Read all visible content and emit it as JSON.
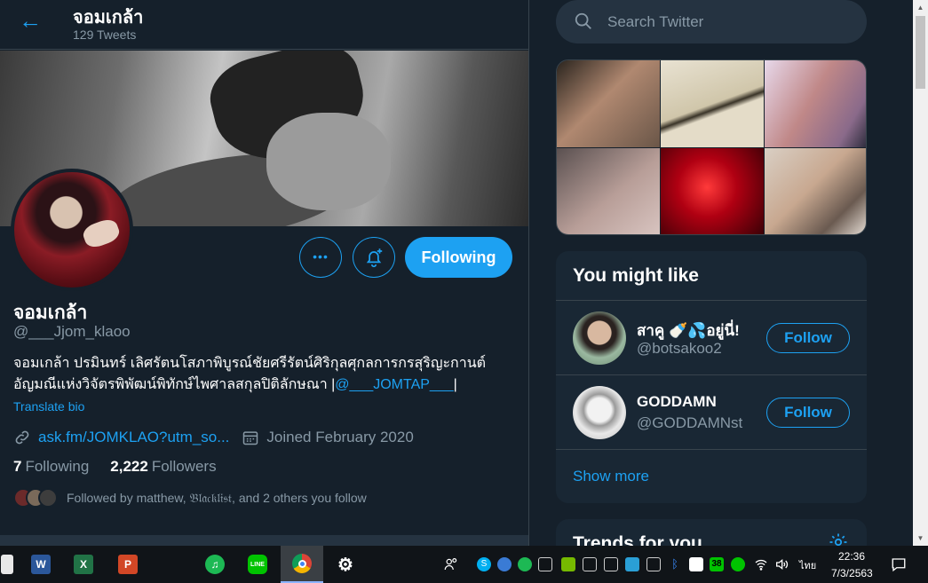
{
  "header": {
    "back_glyph": "←",
    "name": "จอมเกล้า",
    "tweet_count": "129 Tweets"
  },
  "profile": {
    "name": "จอมเกล้า",
    "handle": "@___Jjom_klaoo",
    "bio_text": "จอมเกล้า ปรมินทร์ เลิศรัตนโสภาพิบูรณ์ชัยศรีรัตน์ศิริกุลศุกลการกรสุริญะกานต์ อัญมณีแห่งวิจัตรพิพัฒน์พิทักษ์ไพศาลสกุลปิติลักษณา |",
    "bio_link": "@___JOMTAP___",
    "bio_suffix": "|",
    "translate_bio": "Translate bio",
    "link": "ask.fm/JOMKLAO?utm_so...",
    "joined": "Joined February 2020",
    "following_count": "7",
    "following_label": "Following",
    "followers_count": "2,222",
    "followers_label": "Followers",
    "followed_by": "Followed by matthew, 𝔅𝔩𝔞𝔠𝔨𝔩𝔦𝔰𝔱, and 2 others you follow",
    "more_glyph": "•••",
    "following_button": "Following"
  },
  "search": {
    "placeholder": "Search Twitter"
  },
  "who_to_follow": {
    "title": "You might like",
    "users": [
      {
        "name": "สาคู 🍼💦อยู่นี่!",
        "handle": "@botsakoo2",
        "button": "Follow"
      },
      {
        "name": "GODDAMN",
        "handle": "@GODDAMNst",
        "button": "Follow"
      }
    ],
    "show_more": "Show more"
  },
  "trends": {
    "title": "Trends for you"
  },
  "taskbar": {
    "apps": [
      {
        "name": "word",
        "glyph": "W",
        "color": "#2b579a"
      },
      {
        "name": "excel",
        "glyph": "X",
        "color": "#217346"
      },
      {
        "name": "powerpoint",
        "glyph": "P",
        "color": "#d24726"
      },
      {
        "name": "spotify",
        "glyph": "♫",
        "color": "#1db954"
      },
      {
        "name": "line",
        "glyph": "LINE",
        "color": "#00c300"
      },
      {
        "name": "chrome",
        "glyph": "◉",
        "color": "#db4437"
      },
      {
        "name": "settings",
        "glyph": "⚙",
        "color": "#101418"
      }
    ],
    "tray_badge": "38",
    "lang": "ไทย",
    "time": "22:36",
    "date": "7/3/2563"
  },
  "colors": {
    "accent": "#1da1f2",
    "background": "#15202b",
    "card": "#192734",
    "secondary_text": "#8899a6"
  }
}
